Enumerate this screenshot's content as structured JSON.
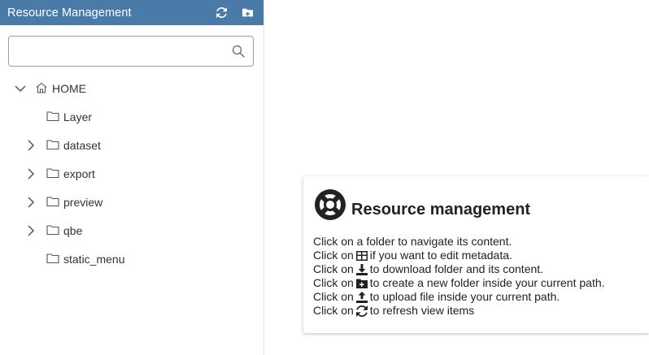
{
  "sidebar": {
    "title": "Resource Management",
    "refresh_icon": "refresh-icon",
    "new_folder_icon": "folder-plus-icon",
    "search": {
      "value": "",
      "placeholder": ""
    },
    "tree": [
      {
        "label": "HOME",
        "icon": "home-icon",
        "expanded": true,
        "has_children": true
      },
      {
        "label": "Layer",
        "icon": "folder-icon",
        "has_children": false
      },
      {
        "label": "dataset",
        "icon": "folder-icon",
        "has_children": true
      },
      {
        "label": "export",
        "icon": "folder-icon",
        "has_children": true
      },
      {
        "label": "preview",
        "icon": "folder-icon",
        "has_children": true
      },
      {
        "label": "qbe",
        "icon": "folder-icon",
        "has_children": true
      },
      {
        "label": "static_menu",
        "icon": "folder-icon",
        "has_children": false
      }
    ]
  },
  "card": {
    "title": "Resource management",
    "icon": "lifebuoy-icon",
    "lines": [
      {
        "pre": "Click on a folder to navigate its content.",
        "icon": "",
        "post": ""
      },
      {
        "pre": "Click on",
        "icon": "table-icon",
        "post": "if you want to edit metadata."
      },
      {
        "pre": "Click on",
        "icon": "download-icon",
        "post": "to download folder and its content."
      },
      {
        "pre": "Click on",
        "icon": "folder-plus-icon",
        "post": "to create a new folder inside your current path."
      },
      {
        "pre": "Click on",
        "icon": "upload-icon",
        "post": "to upload file inside your current path."
      },
      {
        "pre": "Click on",
        "icon": "refresh-icon",
        "post": "to refresh view items"
      }
    ]
  }
}
